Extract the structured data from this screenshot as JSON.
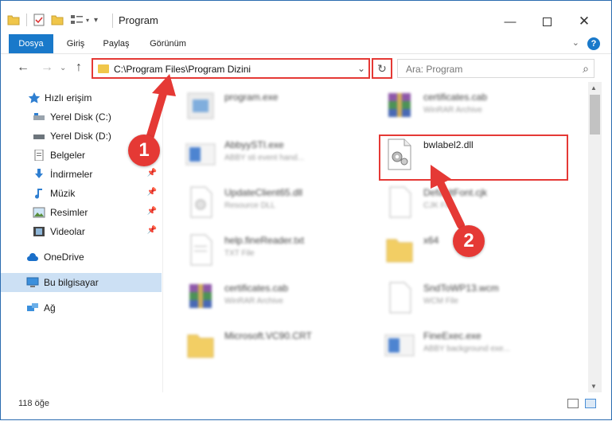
{
  "window": {
    "title": "Program"
  },
  "ribbon": {
    "tabs": [
      "Dosya",
      "Giriş",
      "Paylaş",
      "Görünüm"
    ]
  },
  "address": {
    "path": "C:\\Program Files\\Program Dizini"
  },
  "search": {
    "placeholder": "Ara: Program"
  },
  "sidebar": {
    "items": [
      {
        "label": "Hızlı erişim",
        "icon": "star-icon"
      },
      {
        "label": "Yerel Disk (C:)",
        "icon": "drive-icon"
      },
      {
        "label": "Yerel Disk (D:)",
        "icon": "drive-icon"
      },
      {
        "label": "Belgeler",
        "icon": "documents-icon"
      },
      {
        "label": "İndirmeler",
        "icon": "download-icon"
      },
      {
        "label": "Müzik",
        "icon": "music-icon"
      },
      {
        "label": "Resimler",
        "icon": "pictures-icon"
      },
      {
        "label": "Videolar",
        "icon": "videos-icon"
      },
      {
        "label": "OneDrive",
        "icon": "cloud-icon"
      },
      {
        "label": "Bu bilgisayar",
        "icon": "computer-icon"
      },
      {
        "label": "Ağ",
        "icon": "network-icon"
      }
    ]
  },
  "files": [
    {
      "name": "program.exe",
      "type": "",
      "icon": "exe-icon"
    },
    {
      "name": "certificates.cab",
      "type": "WinRAR Archive",
      "icon": "winrar-icon"
    },
    {
      "name": "AbbyySTI.exe",
      "type": "ABBY sti event hand...",
      "icon": "exe-icon"
    },
    {
      "name": "bwlabel2.dll",
      "type": "",
      "icon": "dll-gear-icon"
    },
    {
      "name": "UpdateClient65.dll",
      "type": "Resource DLL",
      "icon": "dll-icon"
    },
    {
      "name": "DefaultFont.cjk",
      "type": "CJK File",
      "icon": "blank-file-icon"
    },
    {
      "name": "help.fineReader.txt",
      "type": "TXT File",
      "icon": "txt-icon"
    },
    {
      "name": "x64",
      "type": "",
      "icon": "folder-icon"
    },
    {
      "name": "certificates.cab",
      "type": "WinRAR Archive",
      "icon": "winrar-icon"
    },
    {
      "name": "SndToWP13.wcm",
      "type": "WCM File",
      "icon": "blank-file-icon"
    },
    {
      "name": "Microsoft.VC90.CRT",
      "type": "",
      "icon": "folder-icon"
    },
    {
      "name": "FineExec.exe",
      "type": "ABBY background exe...",
      "icon": "exe-icon"
    }
  ],
  "status": {
    "count": "118 öğe"
  },
  "annotations": {
    "badge1": "1",
    "badge2": "2"
  },
  "colors": {
    "accent": "#1979ca",
    "highlight": "#e53935",
    "selected": "#cce0f4"
  }
}
